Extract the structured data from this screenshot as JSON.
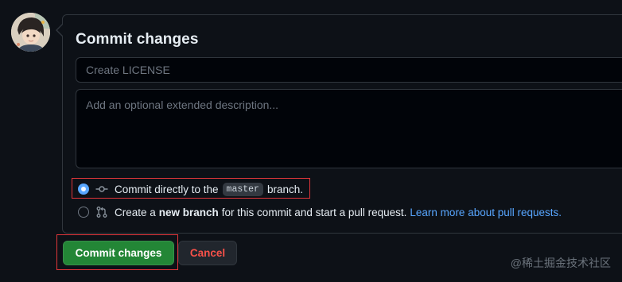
{
  "form": {
    "title": "Commit changes",
    "summary_placeholder": "Create LICENSE",
    "summary_value": "",
    "description_placeholder": "Add an optional extended description..."
  },
  "options": {
    "direct": {
      "prefix": "Commit directly to the",
      "branch": "master",
      "suffix": "branch.",
      "selected": true,
      "icon": "git-commit-icon"
    },
    "new_branch": {
      "prefix": "Create a",
      "bold": "new branch",
      "suffix": "for this commit and start a pull request.",
      "link": "Learn more about pull requests.",
      "selected": false,
      "icon": "git-pull-request-icon"
    }
  },
  "buttons": {
    "commit": "Commit changes",
    "cancel": "Cancel"
  },
  "watermark": "@稀土掘金技术社区",
  "colors": {
    "primary_button": "#238636",
    "cancel_text": "#f85149",
    "link": "#58a6ff",
    "highlight_box": "#e0363a"
  }
}
